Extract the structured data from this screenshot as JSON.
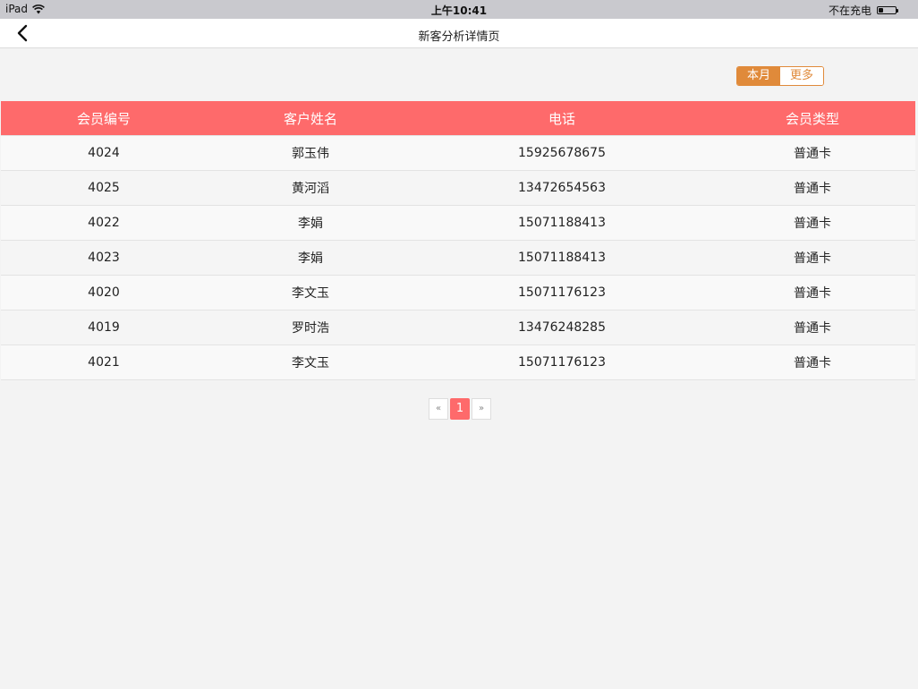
{
  "status_bar": {
    "device": "iPad",
    "time": "上午10:41",
    "charging": "不在充电",
    "battery_level": 0.25
  },
  "nav": {
    "title": "新客分析详情页"
  },
  "segment": {
    "options": [
      "本月",
      "更多"
    ],
    "selected": "本月"
  },
  "table": {
    "headers": [
      "会员编号",
      "客户姓名",
      "电话",
      "会员类型"
    ],
    "rows": [
      [
        "4024",
        "郭玉伟",
        "15925678675",
        "普通卡"
      ],
      [
        "4025",
        "黄河滔",
        "13472654563",
        "普通卡"
      ],
      [
        "4022",
        "李娟",
        "15071188413",
        "普通卡"
      ],
      [
        "4023",
        "李娟",
        "15071188413",
        "普通卡"
      ],
      [
        "4020",
        "李文玉",
        "15071176123",
        "普通卡"
      ],
      [
        "4019",
        "罗时浩",
        "13476248285",
        "普通卡"
      ],
      [
        "4021",
        "李文玉",
        "15071176123",
        "普通卡"
      ]
    ]
  },
  "pagination": {
    "prev": "«",
    "current": "1",
    "next": "»"
  },
  "colors": {
    "accent": "#fe6a6b",
    "segment": "#e08a3a"
  }
}
